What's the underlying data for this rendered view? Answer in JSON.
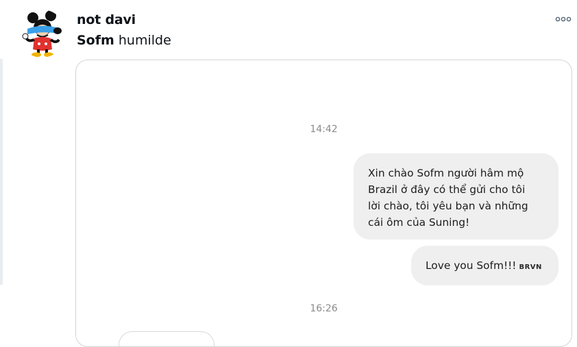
{
  "post": {
    "author_name": "not davi",
    "subtitle_bold": "Sofm",
    "subtitle_rest": "humilde",
    "more_icon": "ellipsis-icon"
  },
  "chat": {
    "timestamp_1": "14:42",
    "message_1": "Xin chào Sofm người hâm mộ\nBrazil ở đây có thể gửi cho tôi\nlời chào, tôi yêu bạn và những\ncái ôm của Suning!",
    "message_2_text": "Love you Sofm!!!",
    "message_2_tag": "BRVN",
    "timestamp_2": "16:26"
  },
  "colors": {
    "bubble_bg": "#efefef",
    "timestamp": "#8a8a8a",
    "card_border": "#d4d4d4"
  }
}
